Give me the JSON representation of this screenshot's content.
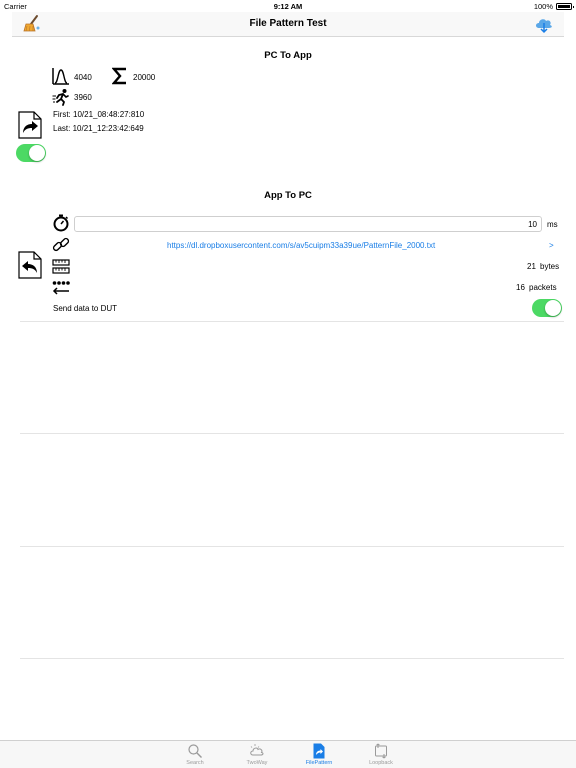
{
  "status_bar": {
    "carrier": "Carrier",
    "time": "9:12 AM",
    "battery": "100%"
  },
  "nav": {
    "title": "File Pattern Test",
    "left_icon": "broom-icon",
    "right_icon": "cloud-download-icon"
  },
  "pc_to_app": {
    "title": "PC To App",
    "peak_value": "4040",
    "sum_value": "20000",
    "rate_value": "3960",
    "first_label": "First: 10/21_08:48:27:810",
    "last_label": "Last: 10/21_12:23:42:649",
    "switch_on": true
  },
  "app_to_pc": {
    "title": "App To PC",
    "interval_value": "10",
    "interval_unit": "ms",
    "file_url": "https://dl.dropboxusercontent.com/s/av5cuipm33a39ue/PatternFile_2000.txt",
    "chevron": ">",
    "bytes_value": "21",
    "bytes_unit": "bytes",
    "packets_value": "16",
    "packets_unit": "packets",
    "send_label": "Send data to DUT",
    "send_on": true
  },
  "tabs": [
    {
      "label": "Search",
      "icon": "search-icon",
      "active": false
    },
    {
      "label": "TwoWay",
      "icon": "twoway-icon",
      "active": false
    },
    {
      "label": "FilePattern",
      "icon": "file-pattern-icon",
      "active": true
    },
    {
      "label": "Loopback",
      "icon": "loopback-icon",
      "active": false
    }
  ],
  "colors": {
    "accent": "#1a7ee6",
    "switch_on": "#4cd964"
  }
}
